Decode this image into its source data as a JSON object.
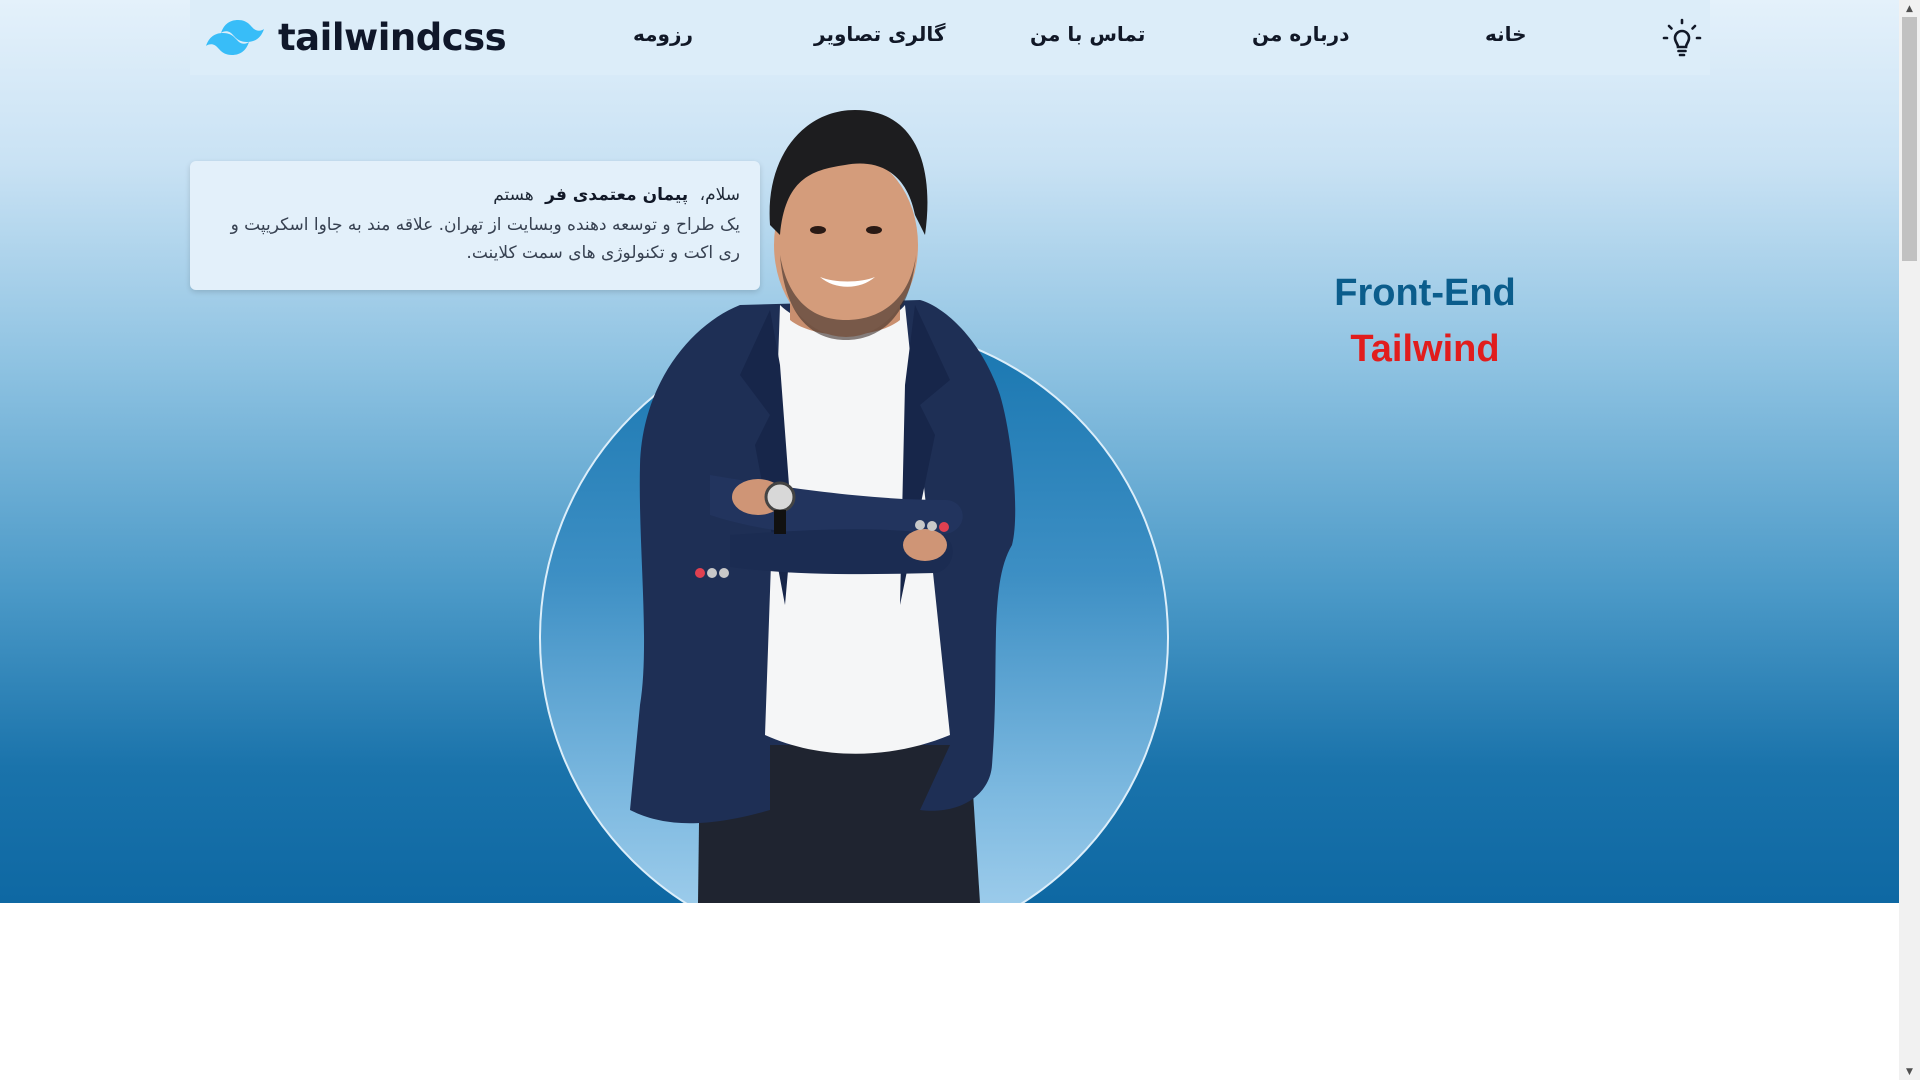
{
  "brand": {
    "logo_text": "tailwindcss",
    "logo_icon": "tailwind-wave-icon",
    "accent_color": "#38bdf8"
  },
  "nav": {
    "items": [
      {
        "label": "رزومه"
      },
      {
        "label": "گالری تصاویر"
      },
      {
        "label": "تماس با من"
      },
      {
        "label": "درباره من"
      },
      {
        "label": "خانه"
      }
    ],
    "theme_icon": "lightbulb-icon"
  },
  "intro": {
    "greeting": "سلام،",
    "name": "پیمان معتمدی فر",
    "suffix": "هستم",
    "description": "یک طراح و توسعه دهنده وبسایت از تهران. علاقه مند به جاوا اسکریپت و ری اکت و تکنولوژی های سمت کلاینت."
  },
  "roles": {
    "primary": "Front-End",
    "secondary": "Tailwind",
    "primary_color": "#0b5d8c",
    "secondary_color": "#e11d1d"
  },
  "portrait": {
    "icon": "profile-portrait-image"
  }
}
